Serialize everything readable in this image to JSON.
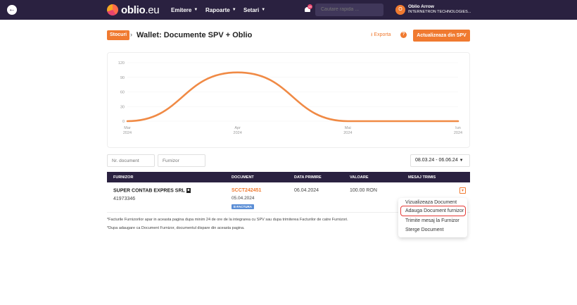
{
  "topbar": {
    "logo_text": "oblio",
    "logo_suffix": ".eu",
    "nav": [
      {
        "label": "Emitere"
      },
      {
        "label": "Rapoarte"
      },
      {
        "label": "Setari"
      }
    ],
    "notification_count": "99",
    "search_placeholder": "Cautare rapida ...",
    "user_initial": "O",
    "user_name": "Oblio Arrow",
    "user_company": "INTERNETRON TECHNOLOGIES..."
  },
  "header": {
    "crumb": "Stocuri",
    "title": "Wallet: Documente SPV + Oblio",
    "export_label": "Exporta",
    "help_icon": "?",
    "action_label": "Actualizeaza din SPV"
  },
  "chart_data": {
    "type": "line",
    "x": [
      "Mar 2024",
      "Apr 2024",
      "Mai 2024",
      "Iun 2024"
    ],
    "x_ticks": [
      {
        "line1": "Mar",
        "line2": "2024"
      },
      {
        "line1": "Apr",
        "line2": "2024"
      },
      {
        "line1": "Mai",
        "line2": "2024"
      },
      {
        "line1": "Iun",
        "line2": "2024"
      }
    ],
    "values": [
      0,
      100,
      0,
      0
    ],
    "y_ticks": [
      "0",
      "30",
      "60",
      "90",
      "120"
    ],
    "ylim": [
      0,
      120
    ],
    "color": "#f08a45",
    "title": "",
    "xlabel": "",
    "ylabel": ""
  },
  "filters": {
    "doc_placeholder": "Nr. document",
    "supplier_placeholder": "Furnizor",
    "date_range": "08.03.24 - 06.06.24"
  },
  "table": {
    "headers": [
      "FURNIZOR",
      "DOCUMENT",
      "DATA PRIMIRE",
      "VALOARE",
      "MESAJ TRIMIS"
    ],
    "rows": [
      {
        "supplier": "SUPER CONTAB EXPRES SRL",
        "supplier_code": "41973346",
        "doc_number": "SCCT242451",
        "doc_date": "05.04.2024",
        "doc_badge": "E-FACTURA",
        "received": "06.04.2024",
        "value": "100.00 RON"
      }
    ]
  },
  "footnotes": [
    "*Facturile Furnizorilor apar in aceasta pagina dupa minim 24 de ore de la integrarea cu SPV sau dupa trimiterea Facturilor de catre Furnizori.",
    "*Dupa adaugare ca Document Furnizor, documentul dispare din aceasta pagina."
  ],
  "dropdown": {
    "items": [
      "Vizualizeaza Document",
      "Adauga Document furnizor",
      "Trimite mesaj la Furnizor",
      "Sterge Document"
    ]
  }
}
